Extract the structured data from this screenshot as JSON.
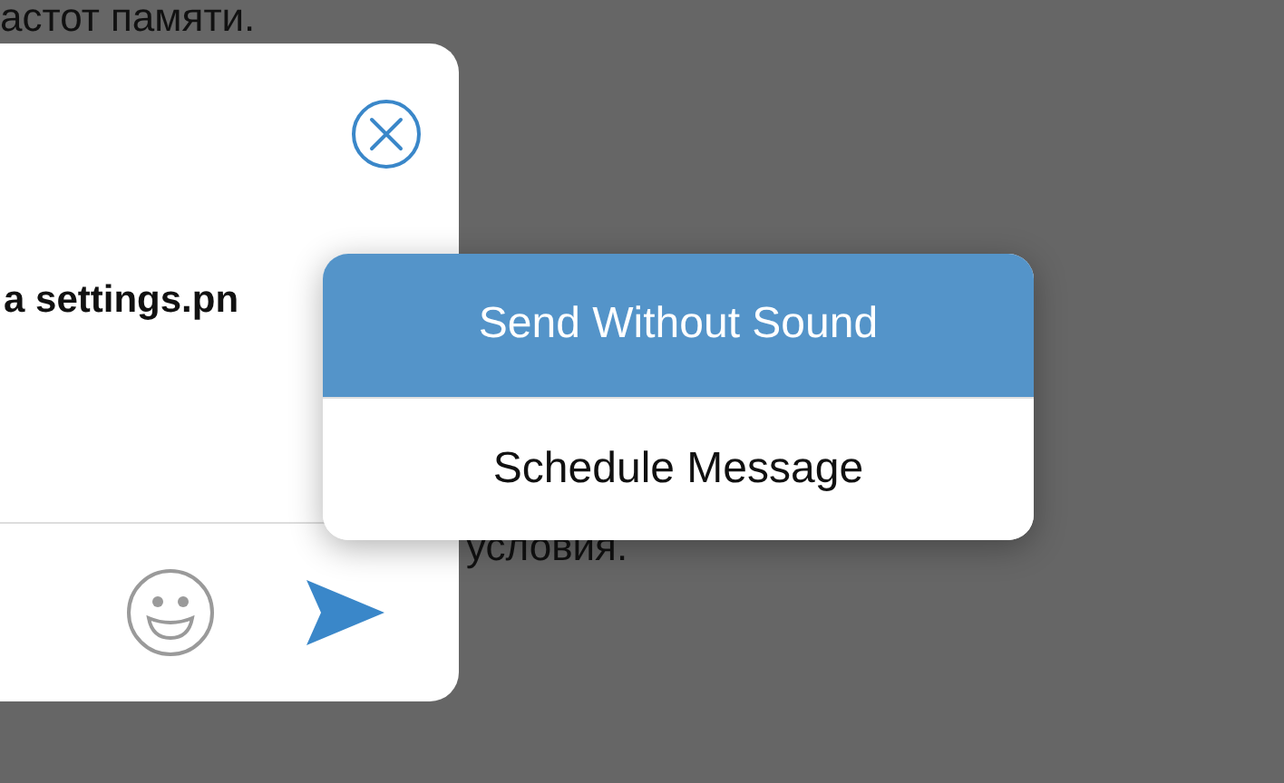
{
  "background_text": [
    "астот памяти.",
    "условия."
  ],
  "dialog": {
    "file_name": "a settings.pn"
  },
  "menu": {
    "items": [
      {
        "label": "Send Without Sound",
        "selected": true
      },
      {
        "label": "Schedule Message",
        "selected": false
      }
    ]
  }
}
